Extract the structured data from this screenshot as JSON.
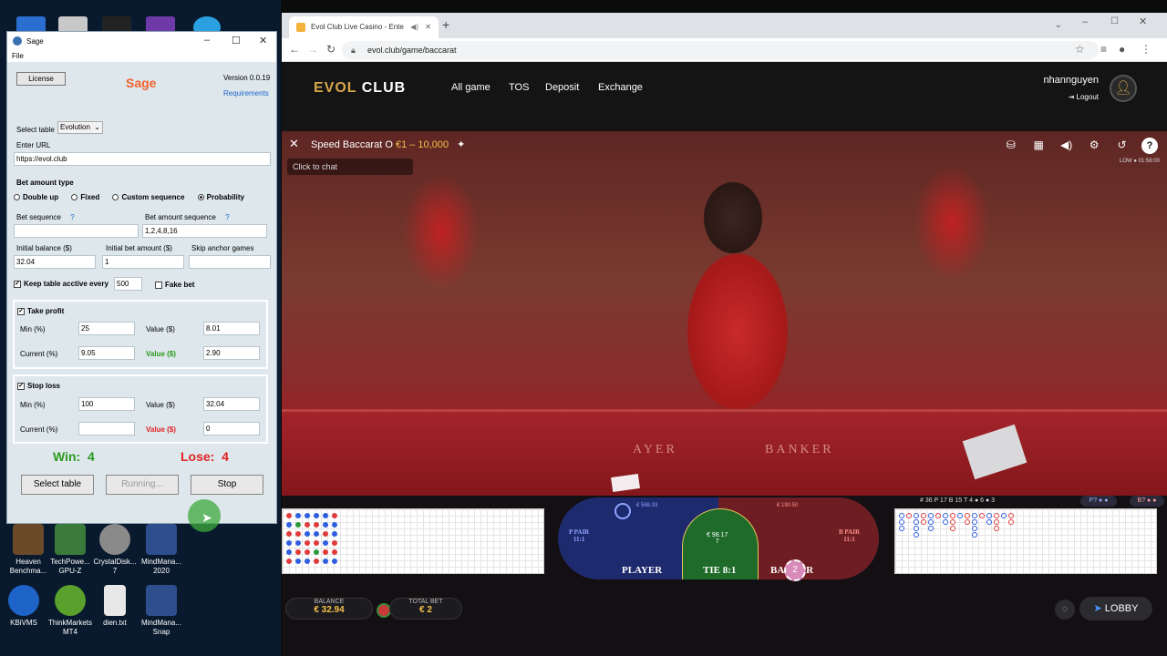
{
  "desktop": {
    "icons": [
      {
        "label": "Heaven\nBenchma...",
        "color": "#6b4a2a"
      },
      {
        "label": "TechPowe...\nGPU-Z",
        "color": "#3a7a3a"
      },
      {
        "label": "CrystalDisk...\n7",
        "color": "#8a8a8a"
      },
      {
        "label": "MindMana...\n2020",
        "color": "#2e4e8e"
      },
      {
        "label": "KBiVMS",
        "color": "#1e64c8"
      },
      {
        "label": "ThinkMarkets\nMT4",
        "color": "#5aa02c"
      },
      {
        "label": "dien.txt",
        "color": "#e8e8e8"
      },
      {
        "label": "MindMana...\nSnap",
        "color": "#2e4e8e"
      }
    ]
  },
  "sage": {
    "window_title": "Sage",
    "menu_file": "File",
    "license_btn": "License",
    "app_title": "Sage",
    "version": "Version 0.0.19",
    "requirements": "Requirements",
    "select_table_label": "Select table",
    "select_table_value": "Evolution",
    "enter_url_label": "Enter URL",
    "url_value": "https://evol.club",
    "bet_amount_type": "Bet amount type",
    "radios": [
      "Double up",
      "Fixed",
      "Custom sequence",
      "Probability"
    ],
    "selected_radio": "Probability",
    "bet_sequence_label": "Bet sequence",
    "bet_amount_sequence_label": "Bet amount sequence",
    "bet_sequence_value": "",
    "bet_amount_sequence_value": "1,2,4,8,16",
    "q_mark": "?",
    "initial_balance_label": "Initial balance ($)",
    "initial_bet_label": "Initial bet amount ($)",
    "skip_anchor_label": "Skip anchor games",
    "initial_balance_value": "32.04",
    "initial_bet_value": "1",
    "skip_anchor_value": "",
    "keep_active_label": "Keep table acctive every",
    "keep_active_value": "500",
    "fake_bet_label": "Fake bet",
    "take_profit": {
      "label": "Take profit",
      "min_label": "Min (%)",
      "min_value": "25",
      "value_label": "Value ($)",
      "value_value": "8.01",
      "current_label": "Current (%)",
      "current_value": "9.05",
      "cur_value_label": "Value ($)",
      "cur_value_value": "2.90"
    },
    "stop_loss": {
      "label": "Stop loss",
      "min_label": "Min (%)",
      "min_value": "100",
      "value_label": "Value ($)",
      "value_value": "32.04",
      "current_label": "Current (%)",
      "current_value": "",
      "cur_value_label": "Value ($)",
      "cur_value_value": "0"
    },
    "win_label": "Win:",
    "win_count": "4",
    "lose_label": "Lose:",
    "lose_count": "4",
    "btn_select_table": "Select table",
    "btn_running": "Running...",
    "btn_stop": "Stop"
  },
  "browser": {
    "tab_title": "Evol Club Live Casino - Ente",
    "new_tab": "+",
    "url": "evol.club/game/baccarat"
  },
  "site": {
    "logo_evol": "EVOL",
    "logo_club": "CLUB",
    "nav": [
      "All game",
      "TOS",
      "Deposit",
      "Exchange"
    ],
    "username": "nhannguyen",
    "logout": "Logout"
  },
  "game": {
    "title": "Speed Baccarat O",
    "limits": "€1 – 10,000",
    "chat_placeholder": "Click to chat",
    "quality_time": "LOW  ● 01:56:00",
    "felt_player": "AYER",
    "felt_banker": "BANKER",
    "stats": "# 36   P 17   B 15   T 4   ● 6   ● 3",
    "pp_label": "P PAIR\n11:1",
    "bp_label": "B PAIR\n11:1",
    "player": "PLAYER",
    "tie": "TIE 8:1",
    "banker": "BANKER",
    "tie_amount": "€ 98.17",
    "tie_count": "7",
    "player_amount": "€ 568.33",
    "banker_amount": "€ 190.50",
    "chip_value": "2",
    "balance_label": "BALANCE",
    "balance_value": "€ 32.94",
    "total_bet_label": "TOTAL BET",
    "total_bet_value": "€ 2",
    "lobby": "LOBBY"
  },
  "colors": {
    "sage_accent": "#f0622e",
    "win": "#2c9a1e",
    "lose": "#e02323",
    "gold": "#d7a64a",
    "player_blue": "#1e2a6e",
    "banker_red": "#6e1e22",
    "tie_green": "#1f6b2a"
  }
}
